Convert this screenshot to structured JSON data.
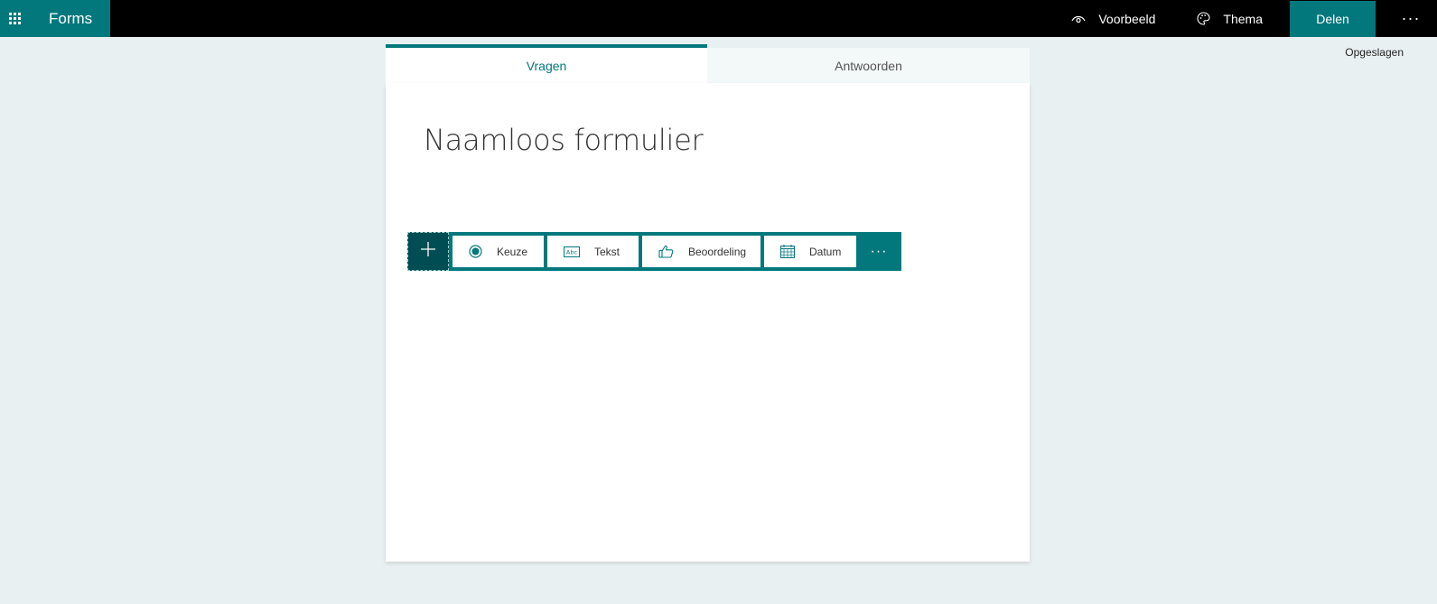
{
  "app": {
    "name": "Forms",
    "accent_color": "#03787c",
    "dark_accent_color": "#004e53"
  },
  "header": {
    "preview_label": "Voorbeeld",
    "theme_label": "Thema",
    "share_label": "Delen",
    "more_label": "···",
    "status": "Opgeslagen"
  },
  "tabs": [
    {
      "label": "Vragen",
      "active": true
    },
    {
      "label": "Antwoorden",
      "active": false
    }
  ],
  "form": {
    "title": "Naamloos formulier"
  },
  "question_toolbar": {
    "add_icon": "plus-icon",
    "types": [
      {
        "label": "Keuze",
        "icon": "radio-icon"
      },
      {
        "label": "Tekst",
        "icon": "text-abc-icon"
      },
      {
        "label": "Beoordeling",
        "icon": "thumbs-up-icon"
      },
      {
        "label": "Datum",
        "icon": "calendar-icon"
      }
    ],
    "more_label": "···"
  }
}
